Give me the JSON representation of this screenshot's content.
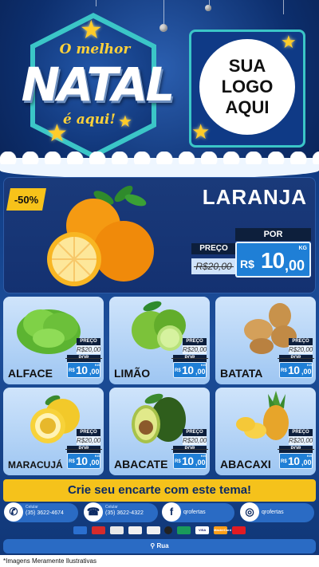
{
  "header": {
    "title_top": "O melhor",
    "title_main": "NATAL",
    "title_bottom": "é aqui!",
    "logo_lines": [
      "SUA",
      "LOGO",
      "AQUI"
    ]
  },
  "featured": {
    "badge": "-50%",
    "name": "LARANJA",
    "preco_label": "PREÇO",
    "old_price": "R$20,00",
    "por_label": "POR",
    "currency": "R$",
    "price_int": "10",
    "price_dec": ",00",
    "unit": "KG"
  },
  "products": [
    {
      "name": "ALFACE",
      "preco_label": "PREÇO",
      "old_price": "R$20,00",
      "por_label": "POR",
      "currency": "R$",
      "price_int": "10",
      "price_dec": ",00",
      "unit": "KG"
    },
    {
      "name": "LIMÃO",
      "preco_label": "PREÇO",
      "old_price": "R$20,00",
      "por_label": "POR",
      "currency": "R$",
      "price_int": "10",
      "price_dec": ",00",
      "unit": "KG"
    },
    {
      "name": "BATATA",
      "preco_label": "PREÇO",
      "old_price": "R$20,00",
      "por_label": "POR",
      "currency": "R$",
      "price_int": "10",
      "price_dec": ",00",
      "unit": "KG"
    },
    {
      "name": "MARACUJÁ",
      "preco_label": "PREÇO",
      "old_price": "R$20,00",
      "por_label": "POR",
      "currency": "R$",
      "price_int": "10",
      "price_dec": ",00",
      "unit": "KG"
    },
    {
      "name": "ABACATE",
      "preco_label": "PREÇO",
      "old_price": "R$20,00",
      "por_label": "POR",
      "currency": "R$",
      "price_int": "10",
      "price_dec": ",00",
      "unit": "KG"
    },
    {
      "name": "ABACAXI",
      "preco_label": "PREÇO",
      "old_price": "R$20,00",
      "por_label": "POR",
      "currency": "R$",
      "price_int": "10",
      "price_dec": ",00",
      "unit": "KG"
    }
  ],
  "cta": "Crie seu encarte com este tema!",
  "contacts": {
    "whatsapp": {
      "label": "Celular",
      "value": "(35) 3622-4674",
      "icon": "whatsapp-icon"
    },
    "phone": {
      "label": "Celular",
      "value": "(35) 3622-4322",
      "icon": "phone-icon"
    },
    "facebook": {
      "value": "qrofertas",
      "icon": "facebook-icon"
    },
    "instagram": {
      "value": "qrofertas",
      "icon": "instagram-icon"
    }
  },
  "payments": [
    "VISA",
    "MasterCard"
  ],
  "address": "Rua",
  "footer": "*Imagens Meramente Ilustrativas",
  "colors": {
    "accent": "#f5c21b",
    "price_blue": "#1f7fd6",
    "dark_label": "#0d1f3c",
    "teal_border": "#3bc6c7"
  }
}
